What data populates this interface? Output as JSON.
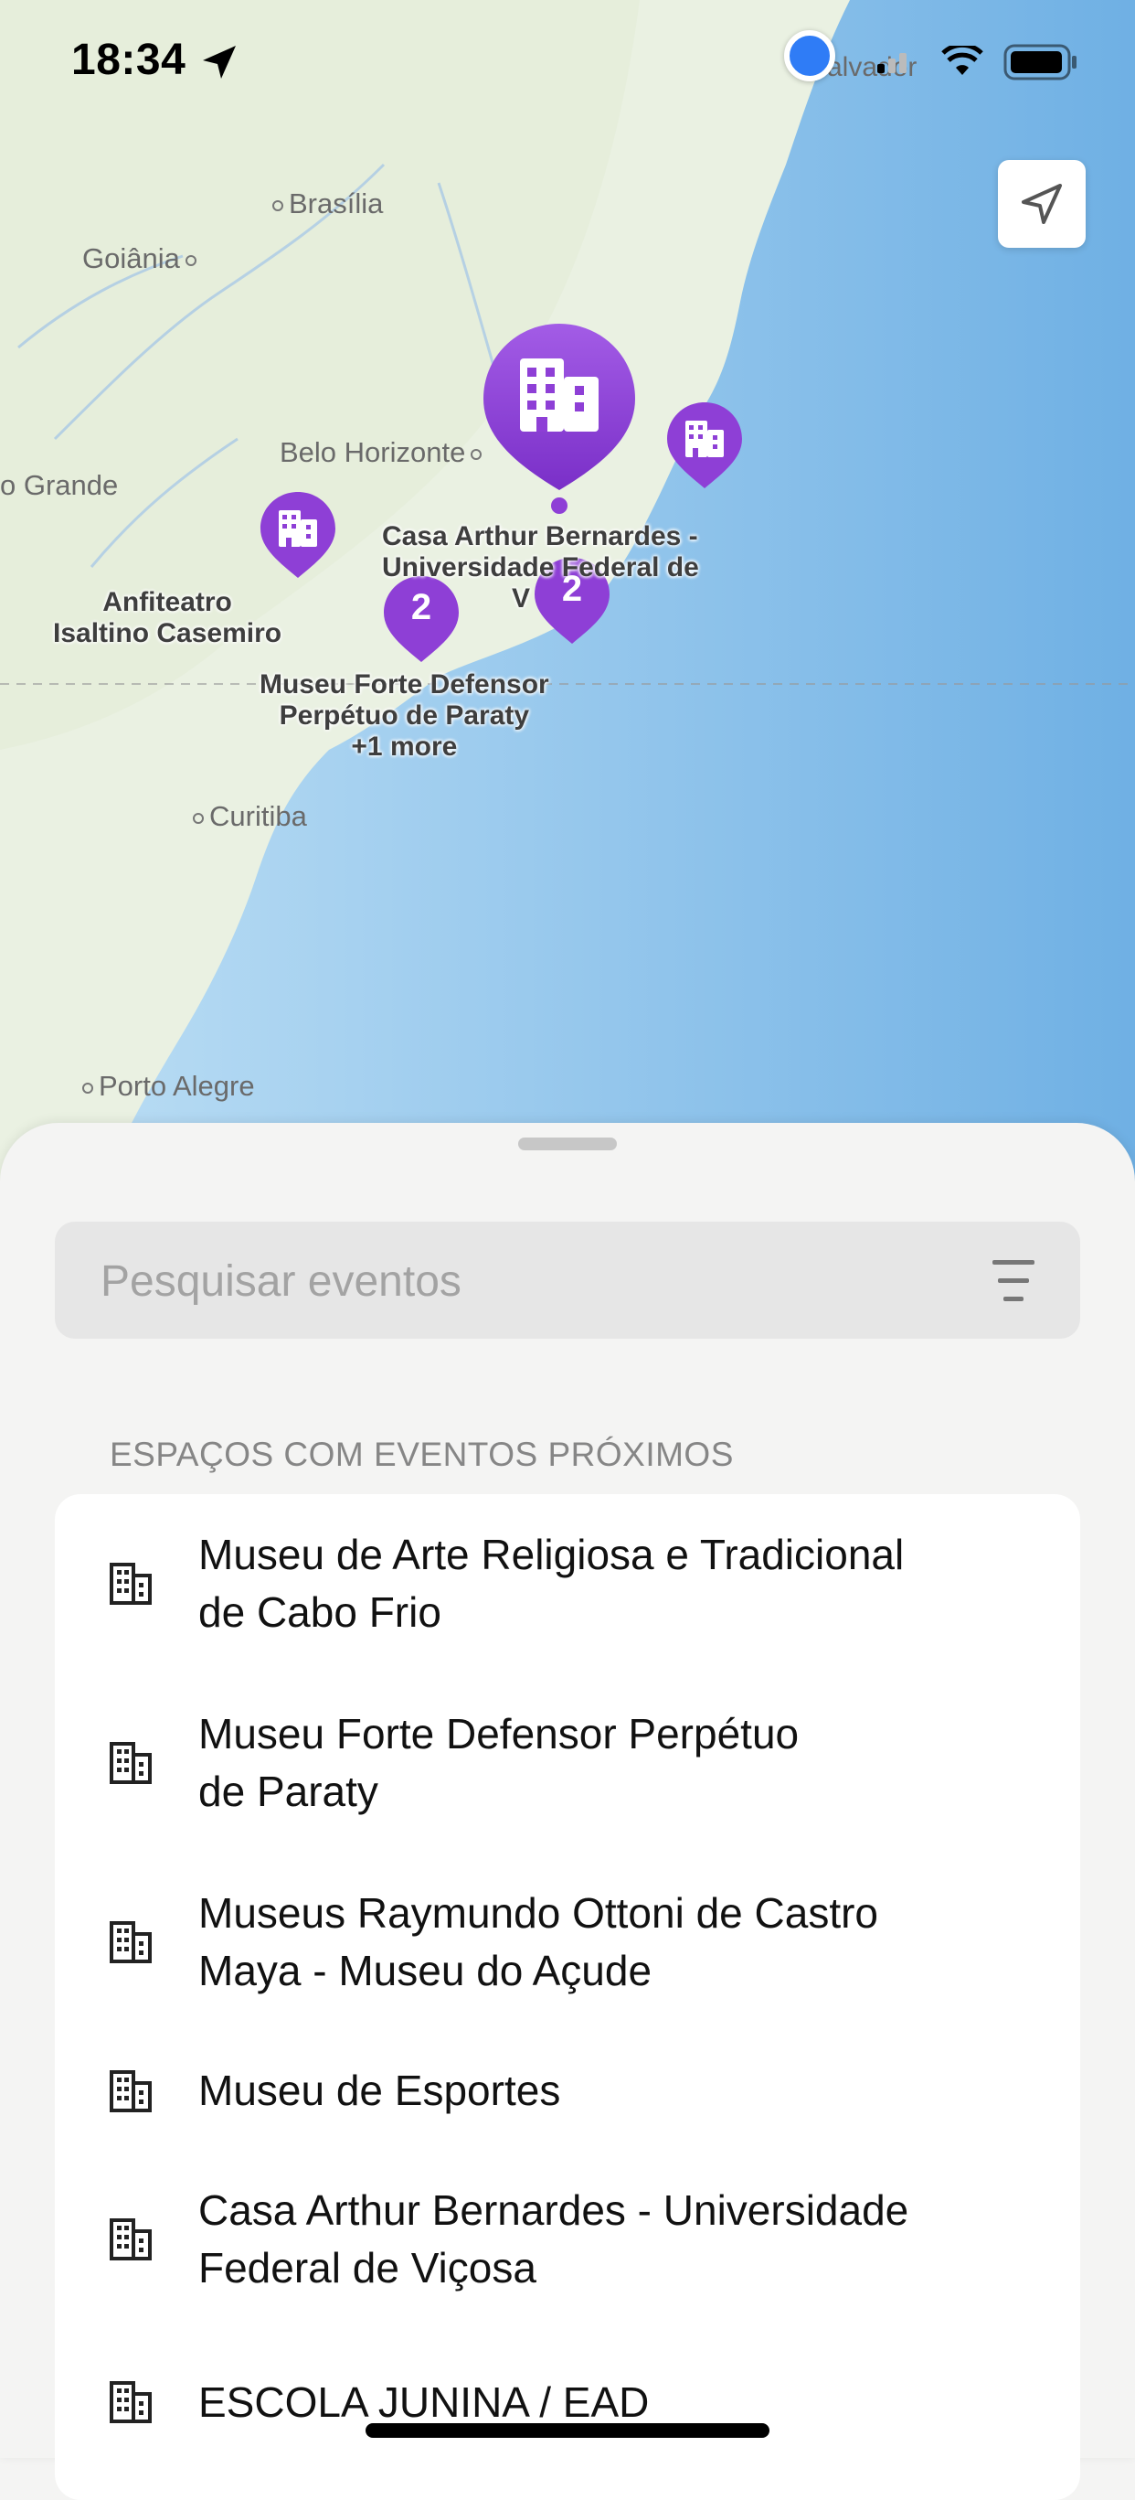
{
  "status_bar": {
    "time": "18:34"
  },
  "map": {
    "cities": [
      "Brasília",
      "Goiânia",
      "Belo Horizonte",
      "o Grande",
      "Curitiba",
      "Porto Alegre",
      "alvador"
    ],
    "pin_labels": {
      "casa_arthur": [
        "Casa Arthur Bernardes -",
        "Universidade Federal de",
        "V"
      ],
      "anfiteatro": [
        "Anfiteatro",
        "Isaltino Casemiro"
      ],
      "museu_forte": [
        "Museu Forte Defensor",
        "Perpétuo de Paraty",
        "+1 more"
      ]
    },
    "cluster_counts": [
      "2",
      "2"
    ]
  },
  "search": {
    "placeholder": "Pesquisar eventos"
  },
  "section": {
    "title": "ESPAÇOS COM EVENTOS PRÓXIMOS"
  },
  "list_items": [
    {
      "name": "Museu de Arte Religiosa e Tradicional de Cabo Frio",
      "lines": [
        "Museu de Arte Religiosa e Tradicional",
        "de Cabo Frio"
      ],
      "icon": "building-icon"
    },
    {
      "name": "Museu Forte Defensor Perpétuo de Paraty",
      "lines": [
        "Museu Forte Defensor Perpétuo",
        "de Paraty"
      ],
      "icon": "building-icon"
    },
    {
      "name": "Museus Raymundo Ottoni de Castro Maya - Museu do Açude",
      "lines": [
        "Museus Raymundo Ottoni de Castro",
        "Maya - Museu do Açude"
      ],
      "icon": "building-icon"
    },
    {
      "name": "Museu de Esportes",
      "lines": [
        "Museu de Esportes"
      ],
      "icon": "building-icon"
    },
    {
      "name": "Casa Arthur Bernardes - Universidade Federal de Viçosa",
      "lines": [
        "Casa Arthur Bernardes - Universidade",
        "Federal de Viçosa"
      ],
      "icon": "building-icon"
    },
    {
      "name": "ESCOLA JUNINA / EAD",
      "lines": [
        "ESCOLA JUNINA / EAD"
      ],
      "icon": "building-icon"
    }
  ],
  "colors": {
    "pin_purple": "#8e3fd6",
    "ocean": "#8cc4ec",
    "land": "#eaf1e2",
    "user_dot": "#2f7cf6"
  }
}
